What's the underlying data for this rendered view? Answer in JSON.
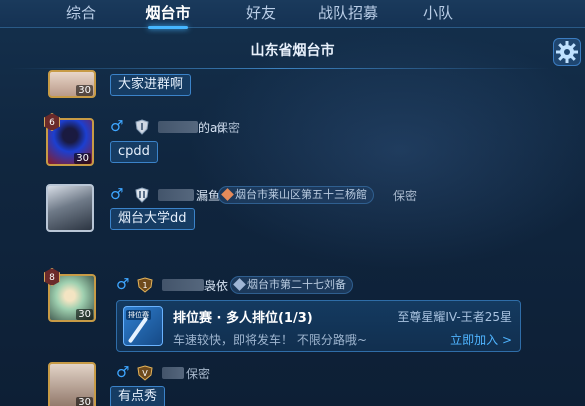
{
  "tabs": [
    "综合",
    "烟台市",
    "好友",
    "战队招募",
    "小队"
  ],
  "active_tab": "烟台市",
  "region_title": "山东省烟台市",
  "colors": {
    "accent": "#46b6ff",
    "male": "#3ea6ff",
    "bubble_border": "#3b83c9"
  },
  "posts": [
    {
      "level": "30",
      "message": "大家进群啊"
    },
    {
      "badge": "6",
      "level": "30",
      "name_suffix": "的ad",
      "privacy": "保密",
      "message": "cpdd"
    },
    {
      "name_suffix": "漏鱼",
      "location": "烟台市莱山区第五十三杨館",
      "privacy": "保密",
      "message": "烟台大学dd"
    },
    {
      "badge": "8",
      "level": "30",
      "name_suffix": "袅依",
      "location": "烟台市第二十七刘备"
    },
    {
      "level": "30",
      "privacy": "保密",
      "message": "有点秀"
    }
  ],
  "invite": {
    "logo_label": "排位赛",
    "title": "排位赛 · 多人排位(1/3)",
    "rank_range": "至尊星耀IV-王者25星",
    "message": "车速较快，即将发车！ 不限分路哦~",
    "join_label": "立即加入 >"
  }
}
